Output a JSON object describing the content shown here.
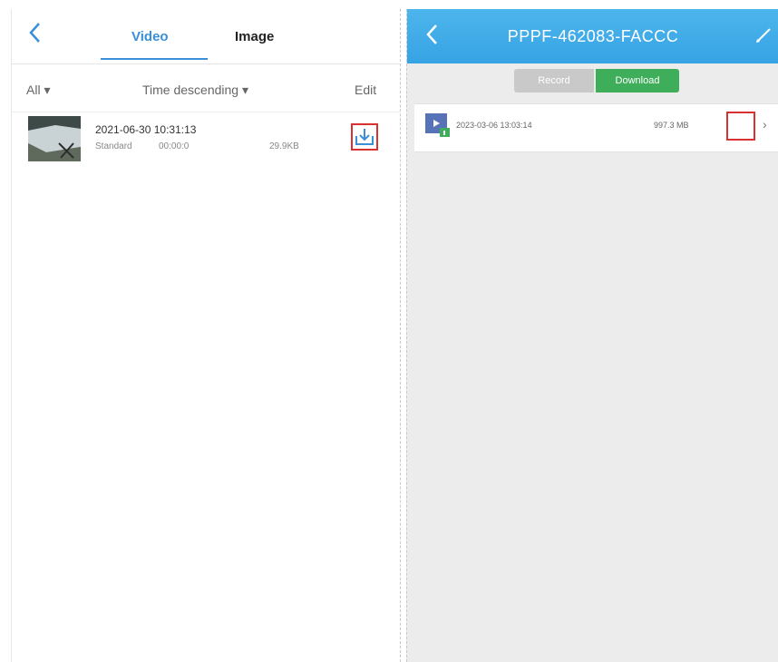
{
  "left": {
    "tabs": [
      {
        "label": "Video",
        "active": true
      },
      {
        "label": "Image",
        "active": false
      }
    ],
    "filter": {
      "all_label": "All ▾",
      "sort_label": "Time descending ▾",
      "edit_label": "Edit"
    },
    "video_item": {
      "title": "2021-06-30 10:31:13",
      "resolution": "Standard",
      "duration": "00:00:0",
      "size": "29.9KB"
    },
    "colors": {
      "accent": "#3a8fd8",
      "highlight_box": "#d93030"
    }
  },
  "right": {
    "device_title": "PPPF-462083-FACCC",
    "segments": [
      {
        "label": "Record",
        "active": false
      },
      {
        "label": "Download",
        "active": true
      }
    ],
    "file_row": {
      "date": "2023-03-06 13:03:14",
      "size": "997.3 MB"
    },
    "colors": {
      "header": "#3aa6e6",
      "active_segment": "#3fae5a",
      "inactive_segment": "#c9c9c9"
    }
  }
}
